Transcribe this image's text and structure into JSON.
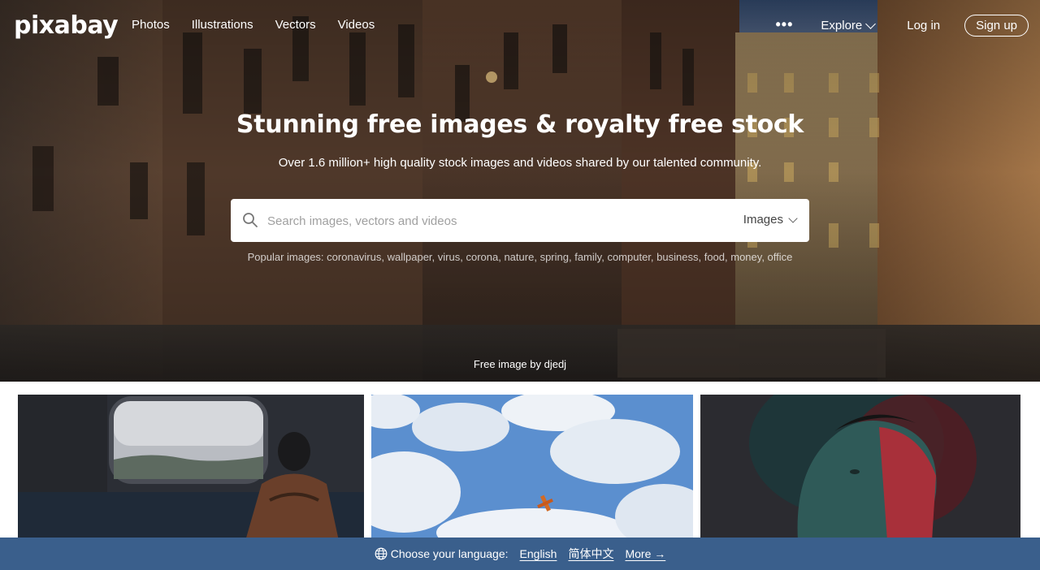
{
  "nav": {
    "logo": "pixabay",
    "links": [
      "Photos",
      "Illustrations",
      "Vectors",
      "Videos"
    ],
    "more_glyph": "•••",
    "explore_label": "Explore",
    "login_label": "Log in",
    "signup_label": "Sign up"
  },
  "hero": {
    "title": "Stunning free images & royalty free stock",
    "subtitle": "Over 1.6 million+ high quality stock images and videos shared by our talented community.",
    "credit": "Free image by djedj"
  },
  "search": {
    "placeholder": "Search images, vectors and videos",
    "type_selected": "Images"
  },
  "popular": {
    "label": "Popular images:",
    "terms": [
      "coronavirus",
      "wallpaper",
      "virus",
      "corona",
      "nature",
      "spring",
      "family",
      "computer",
      "business",
      "food",
      "money",
      "office"
    ]
  },
  "language": {
    "label": "Choose your language:",
    "options": [
      "English",
      "简体中文"
    ],
    "more": "More →"
  },
  "colors": {
    "language_bar": "#3a5f8c",
    "hero_text": "#ffffff"
  }
}
